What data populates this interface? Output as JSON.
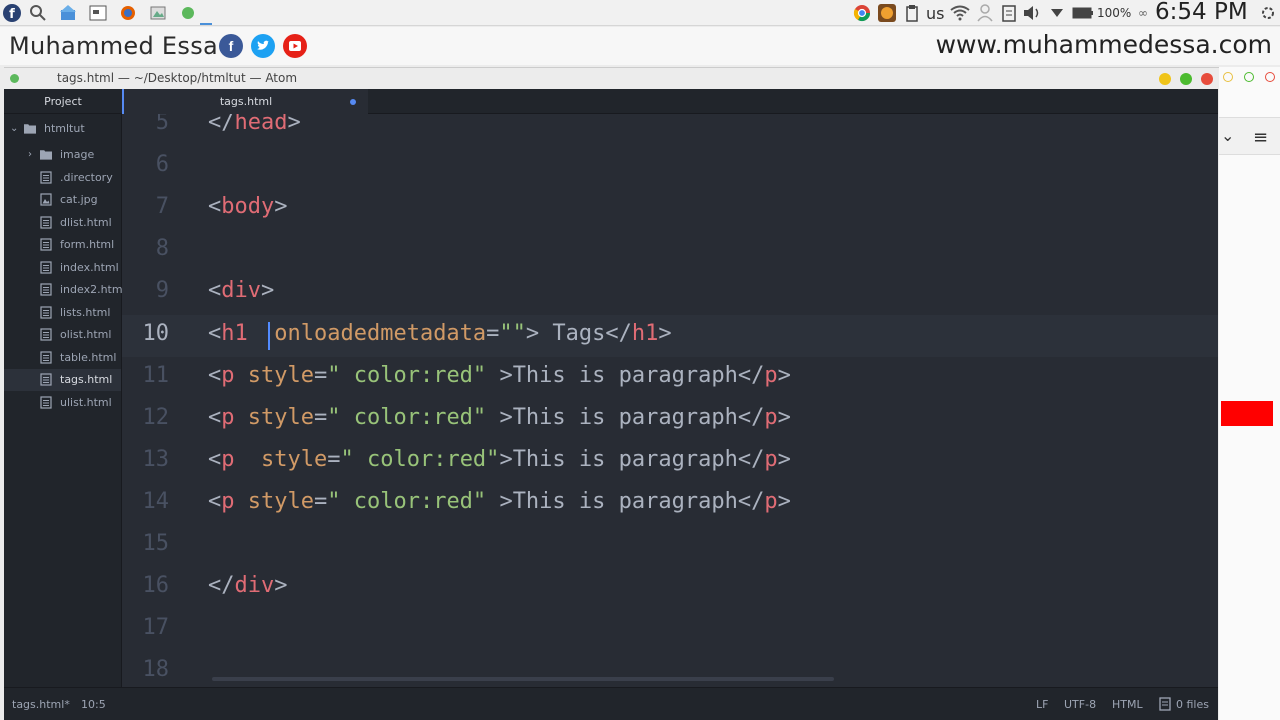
{
  "system": {
    "keyboard": "us",
    "battery": "100%",
    "time": "6:54 PM"
  },
  "watermark": {
    "author": "Muhammed Essa",
    "website": "www.muhammedessa.com",
    "social": [
      {
        "name": "facebook",
        "letter": "f",
        "color": "#3b5998"
      },
      {
        "name": "twitter",
        "letter": "t",
        "color": "#1da1f2"
      },
      {
        "name": "youtube",
        "letter": "▶",
        "color": "#e62117"
      }
    ]
  },
  "window": {
    "title": "tags.html — ~/Desktop/htmltut — Atom"
  },
  "sidebar": {
    "header": "Project",
    "root": "htmltut",
    "items": [
      {
        "label": "image",
        "type": "folder"
      },
      {
        "label": ".directory",
        "type": "file"
      },
      {
        "label": "cat.jpg",
        "type": "image"
      },
      {
        "label": "dlist.html",
        "type": "file"
      },
      {
        "label": "form.html",
        "type": "file"
      },
      {
        "label": "index.html",
        "type": "file"
      },
      {
        "label": "index2.html",
        "type": "file"
      },
      {
        "label": "lists.html",
        "type": "file"
      },
      {
        "label": "olist.html",
        "type": "file"
      },
      {
        "label": "table.html",
        "type": "file"
      },
      {
        "label": "tags.html",
        "type": "file",
        "selected": true
      },
      {
        "label": "ulist.html",
        "type": "file"
      }
    ]
  },
  "tab": {
    "label": "tags.html",
    "modified": true
  },
  "editor": {
    "current_line": "10",
    "lines": [
      {
        "n": "5",
        "code": "</head>"
      },
      {
        "n": "6",
        "code": ""
      },
      {
        "n": "7",
        "code": "<body>"
      },
      {
        "n": "8",
        "code": ""
      },
      {
        "n": "9",
        "code": "<div>"
      },
      {
        "n": "10",
        "code": "<h1  onloadedmetadata=\"\"> Tags</h1>"
      },
      {
        "n": "11",
        "code": "<p style=\" color:red\" >This is paragraph</p>"
      },
      {
        "n": "12",
        "code": "<p style=\" color:red\" >This is paragraph</p>"
      },
      {
        "n": "13",
        "code": "<p  style=\" color:red\">This is paragraph</p>"
      },
      {
        "n": "14",
        "code": "<p style=\" color:red\" >This is paragraph</p>"
      },
      {
        "n": "15",
        "code": ""
      },
      {
        "n": "16",
        "code": "</div>"
      },
      {
        "n": "17",
        "code": ""
      },
      {
        "n": "18",
        "code": ""
      }
    ]
  },
  "status": {
    "file": "tags.html*",
    "position": "10:5",
    "line_ending": "LF",
    "encoding": "UTF-8",
    "grammar": "HTML",
    "files": "0 files"
  },
  "colors": {
    "editor_bg": "#282c34",
    "tag": "#e06c75",
    "attr": "#d19a66",
    "string": "#98c379",
    "accent": "#568af2"
  }
}
